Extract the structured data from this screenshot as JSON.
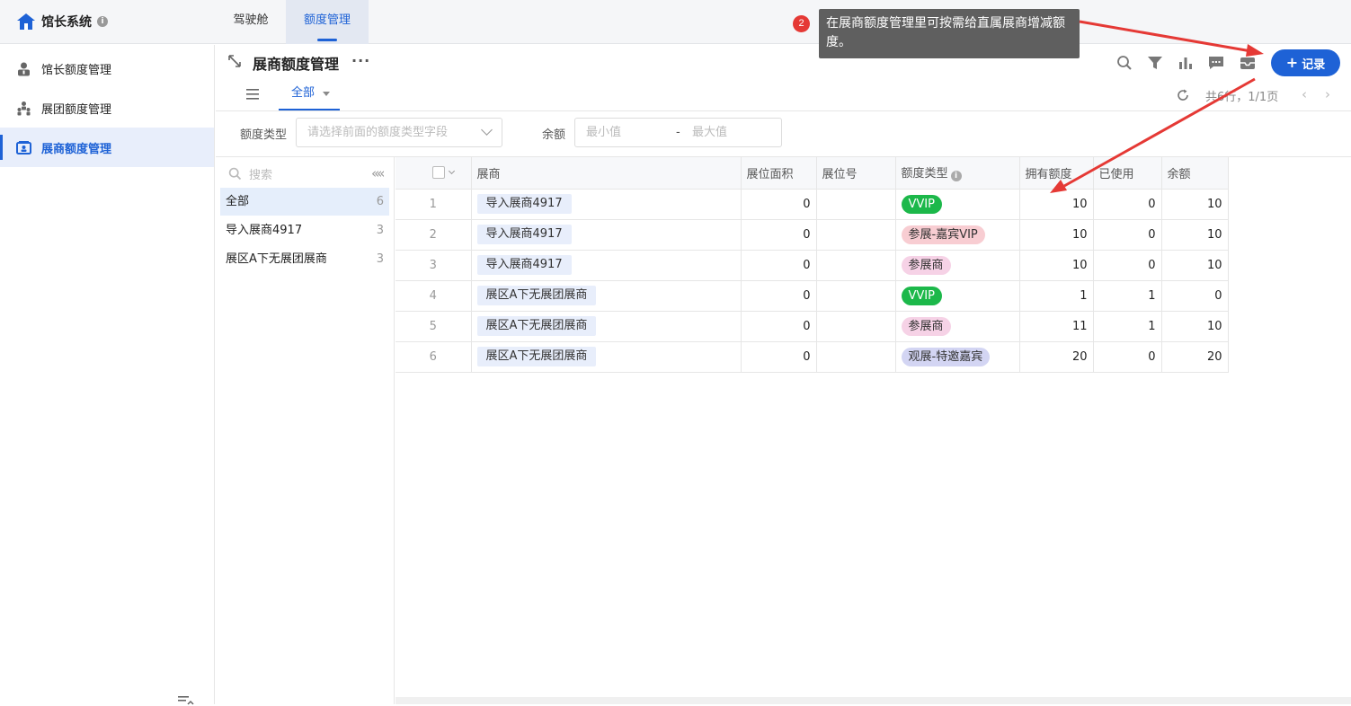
{
  "app": {
    "title": "馆长系统",
    "info_icon": "i"
  },
  "top_tabs": [
    {
      "label": "驾驶舱",
      "active": false
    },
    {
      "label": "额度管理",
      "active": true
    }
  ],
  "tooltip": {
    "step": "2",
    "text": "在展商额度管理里可按需给直属展商增减额度。"
  },
  "sidebar": {
    "items": [
      {
        "label": "馆长额度管理",
        "icon": "curator-icon",
        "active": false
      },
      {
        "label": "展团额度管理",
        "icon": "group-icon",
        "active": false
      },
      {
        "label": "展商额度管理",
        "icon": "exhibitor-card-icon",
        "active": true
      }
    ]
  },
  "header": {
    "title": "展商额度管理",
    "more": "···",
    "add_button": "记录",
    "add_plus": "+"
  },
  "view": {
    "tab_label": "全部",
    "pager_text": "共6行，1/1页",
    "prev": "‹",
    "next": "›"
  },
  "filters": {
    "type_label": "额度类型",
    "type_placeholder": "请选择前面的额度类型字段",
    "balance_label": "余额",
    "min_placeholder": "最小值",
    "range_sep": "-",
    "max_placeholder": "最大值"
  },
  "groups": {
    "search_placeholder": "搜索",
    "collapse": "«",
    "items": [
      {
        "label": "全部",
        "count": "6",
        "active": true
      },
      {
        "label": "导入展商4917",
        "count": "3",
        "active": false
      },
      {
        "label": "展区A下无展团展商",
        "count": "3",
        "active": false
      }
    ]
  },
  "table": {
    "columns": [
      "展商",
      "展位面积",
      "展位号",
      "额度类型",
      "拥有额度",
      "已使用",
      "余额"
    ],
    "rows": [
      {
        "idx": "1",
        "exhibitor": "导入展商4917",
        "area": "0",
        "booth": "",
        "type": "VVIP",
        "type_style": "vvip",
        "owned": "10",
        "used": "0",
        "balance": "10"
      },
      {
        "idx": "2",
        "exhibitor": "导入展商4917",
        "area": "0",
        "booth": "",
        "type": "参展-嘉宾VIP",
        "type_style": "pink",
        "owned": "10",
        "used": "0",
        "balance": "10"
      },
      {
        "idx": "3",
        "exhibitor": "导入展商4917",
        "area": "0",
        "booth": "",
        "type": "参展商",
        "type_style": "pinklight",
        "owned": "10",
        "used": "0",
        "balance": "10"
      },
      {
        "idx": "4",
        "exhibitor": "展区A下无展团展商",
        "area": "0",
        "booth": "",
        "type": "VVIP",
        "type_style": "vvip",
        "owned": "1",
        "used": "1",
        "balance": "0"
      },
      {
        "idx": "5",
        "exhibitor": "展区A下无展团展商",
        "area": "0",
        "booth": "",
        "type": "参展商",
        "type_style": "pinklight",
        "owned": "11",
        "used": "1",
        "balance": "10"
      },
      {
        "idx": "6",
        "exhibitor": "展区A下无展团展商",
        "area": "0",
        "booth": "",
        "type": "观展-特邀嘉宾",
        "type_style": "purple",
        "owned": "20",
        "used": "0",
        "balance": "20"
      }
    ]
  },
  "tag_colors": {
    "vvip": {
      "bg": "#1cb84a",
      "fg": "#ffffff"
    },
    "pink": {
      "bg": "#f8cdd2",
      "fg": "#333333"
    },
    "pinklight": {
      "bg": "#f6d2e6",
      "fg": "#333333"
    },
    "purple": {
      "bg": "#d3d5f3",
      "fg": "#333333"
    }
  },
  "accent_color": "#1e62d6",
  "annotation_color": "#e53935"
}
